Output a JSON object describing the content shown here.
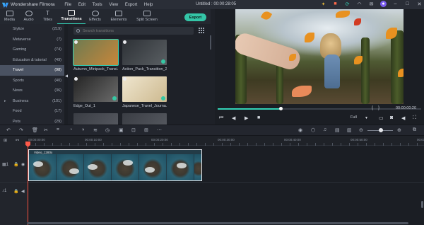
{
  "titlebar": {
    "app_name": "Wondershare Filmora",
    "menu": [
      "File",
      "Edit",
      "Tools",
      "View",
      "Export",
      "Help"
    ],
    "project_title": "Untitled : 00:00:28:05"
  },
  "tabs": [
    {
      "label": "Media",
      "active": false
    },
    {
      "label": "Audio",
      "active": false
    },
    {
      "label": "Titles",
      "active": false
    },
    {
      "label": "Transitions",
      "active": true
    },
    {
      "label": "Effects",
      "active": false
    },
    {
      "label": "Elements",
      "active": false
    },
    {
      "label": "Split Screen",
      "active": false
    }
  ],
  "export_label": "Export",
  "categories": [
    {
      "name": "Stylize",
      "count": "(219)",
      "active": false,
      "expandable": false
    },
    {
      "name": "Metaverse",
      "count": "(7)",
      "active": false,
      "expandable": false
    },
    {
      "name": "Gaming",
      "count": "(74)",
      "active": false,
      "expandable": false
    },
    {
      "name": "Education & tutorial",
      "count": "(49)",
      "active": false,
      "expandable": false
    },
    {
      "name": "Travel",
      "count": "(98)",
      "active": true,
      "expandable": false
    },
    {
      "name": "Sports",
      "count": "(40)",
      "active": false,
      "expandable": false
    },
    {
      "name": "News",
      "count": "(36)",
      "active": false,
      "expandable": false
    },
    {
      "name": "Business",
      "count": "(101)",
      "active": false,
      "expandable": true
    },
    {
      "name": "Food",
      "count": "(17)",
      "active": false,
      "expandable": false
    },
    {
      "name": "Pets",
      "count": "(29)",
      "active": false,
      "expandable": false
    }
  ],
  "search": {
    "placeholder": "Search transitions"
  },
  "transitions": [
    {
      "label": "Autumn_Minipack_Transi...",
      "selected": true,
      "colors": [
        "#6d7b51",
        "#c8863a"
      ]
    },
    {
      "label": "Action_Pack_Transition_2",
      "selected": false,
      "colors": [
        "#2d3136",
        "#5a5f63"
      ]
    },
    {
      "label": "Edge_Out_1",
      "selected": false,
      "colors": [
        "#242424",
        "#6b6b6b"
      ]
    },
    {
      "label": "Japanese_Travel_Journa...",
      "selected": false,
      "colors": [
        "#efe6cf",
        "#cdb98f"
      ]
    }
  ],
  "preview": {
    "timecode": "00:00:00:20",
    "braces": [
      "{",
      "}"
    ],
    "quality": "Full",
    "progress": 0.31
  },
  "timeline": {
    "ruler_labels": [
      "00:00:00:00",
      "00:00:10:00",
      "00:00:20:00",
      "00:00:30:00",
      "00:00:40:00",
      "00:00:50:00",
      "00:01:00:00"
    ],
    "clip_label": "Video_1280x"
  },
  "colors": {
    "accent": "#33d2b6",
    "playhead": "#ff5a4a"
  }
}
